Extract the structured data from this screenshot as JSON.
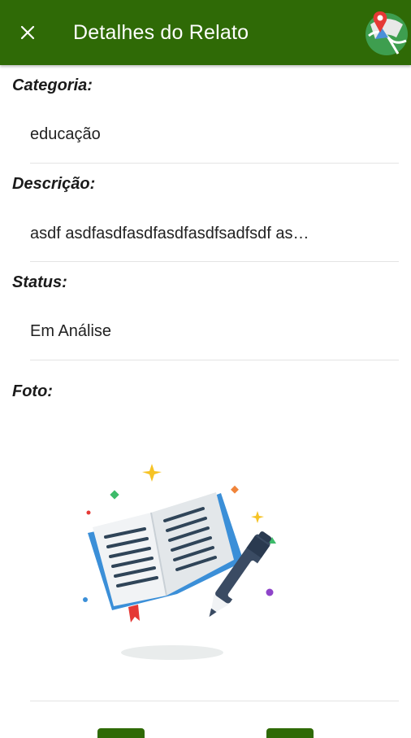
{
  "header": {
    "title": "Detalhes do Relato"
  },
  "sections": {
    "categoria": {
      "label": "Categoria:",
      "value": "educação"
    },
    "descricao": {
      "label": "Descrição:",
      "value": "asdf asdfasdfasdfasdfasdfsadfsdf as…"
    },
    "status": {
      "label": "Status:",
      "value": "Em Análise"
    },
    "foto": {
      "label": "Foto:"
    }
  },
  "colors": {
    "appbar": "#2f6a06",
    "book": "#3b8fd8",
    "pen": "#3a4b63"
  },
  "icons": {
    "close": "close-icon",
    "map": "map-location-icon",
    "photo": "book-pen-illustration"
  }
}
